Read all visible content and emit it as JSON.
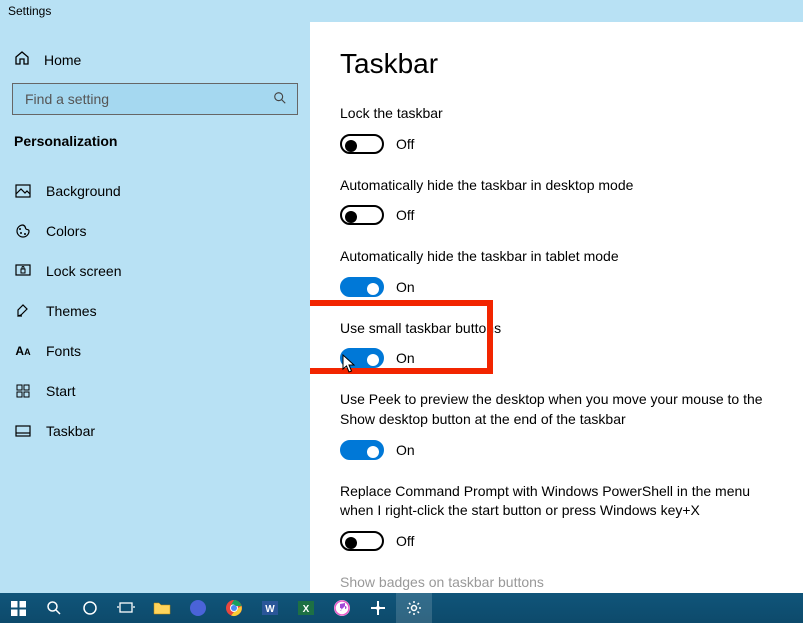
{
  "titlebar": {
    "title": "Settings"
  },
  "sidebar": {
    "home": "Home",
    "search": {
      "placeholder": "Find a setting"
    },
    "section": "Personalization",
    "items": [
      {
        "label": "Background",
        "icon": "background"
      },
      {
        "label": "Colors",
        "icon": "colors"
      },
      {
        "label": "Lock screen",
        "icon": "lockscreen"
      },
      {
        "label": "Themes",
        "icon": "themes"
      },
      {
        "label": "Fonts",
        "icon": "fonts"
      },
      {
        "label": "Start",
        "icon": "start"
      },
      {
        "label": "Taskbar",
        "icon": "taskbar"
      }
    ]
  },
  "main": {
    "title": "Taskbar",
    "settings": [
      {
        "label": "Lock the taskbar",
        "state": "Off",
        "on": false
      },
      {
        "label": "Automatically hide the taskbar in desktop mode",
        "state": "Off",
        "on": false
      },
      {
        "label": "Automatically hide the taskbar in tablet mode",
        "state": "On",
        "on": true
      },
      {
        "label": "Use small taskbar buttons",
        "state": "On",
        "on": true
      },
      {
        "label": "Use Peek to preview the desktop when you move your mouse to the Show desktop button at the end of the taskbar",
        "state": "On",
        "on": true
      },
      {
        "label": "Replace Command Prompt with Windows PowerShell in the menu when I right-click the start button or press Windows key+X",
        "state": "Off",
        "on": false
      },
      {
        "label": "Show badges on taskbar buttons",
        "state": "",
        "on": false,
        "disabled": true
      }
    ]
  },
  "colors": {
    "accent": "#0078d7",
    "sidebar": "#b8e1f4",
    "highlight": "#f22500",
    "taskbar": "#0e5174"
  },
  "taskbar": {
    "items": [
      "start",
      "search",
      "cortana",
      "taskview",
      "file-explorer",
      "firefox",
      "chrome",
      "word",
      "excel",
      "itunes",
      "app",
      "settings"
    ]
  }
}
